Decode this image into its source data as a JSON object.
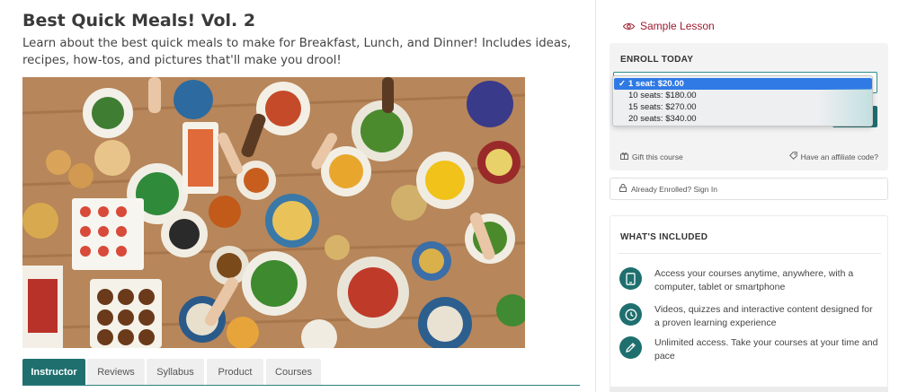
{
  "course": {
    "title": "Best Quick Meals! Vol. 2",
    "description": "Learn about the best quick meals to make for Breakfast, Lunch, and Dinner! Includes ideas, recipes, how-tos, and pictures that'll make you drool!"
  },
  "tabs": [
    {
      "label": "Instructor",
      "active": true
    },
    {
      "label": "Reviews",
      "active": false
    },
    {
      "label": "Syllabus",
      "active": false
    },
    {
      "label": "Product",
      "active": false
    },
    {
      "label": "Courses",
      "active": false
    }
  ],
  "sidebar": {
    "sample_lesson": "Sample Lesson",
    "enroll_heading": "ENROLL TODAY",
    "seat_options": [
      {
        "label": "1 seat: $20.00",
        "selected": true
      },
      {
        "label": "10 seats: $180.00",
        "selected": false
      },
      {
        "label": "15 seats: $270.00",
        "selected": false
      },
      {
        "label": "20 seats: $340.00",
        "selected": false
      }
    ],
    "check_mark": "✓",
    "gift_link": "Gift this course",
    "affiliate_link": "Have an affiliate code?",
    "signin": "Already Enrolled? Sign In",
    "included_heading": "WHAT'S INCLUDED",
    "features": [
      {
        "icon": "smartphone-icon",
        "text": "Access your courses anytime, anywhere, with a computer, tablet or smartphone"
      },
      {
        "icon": "clock-icon",
        "text": "Videos, quizzes and interactive content designed for a proven learning experience"
      },
      {
        "icon": "pencil-icon",
        "text": "Unlimited access. Take your courses at your time and pace"
      }
    ]
  },
  "colors": {
    "accent": "#1f6f6f",
    "sample_lesson": "#9b1c2e",
    "selected_option": "#2f7ae5"
  }
}
